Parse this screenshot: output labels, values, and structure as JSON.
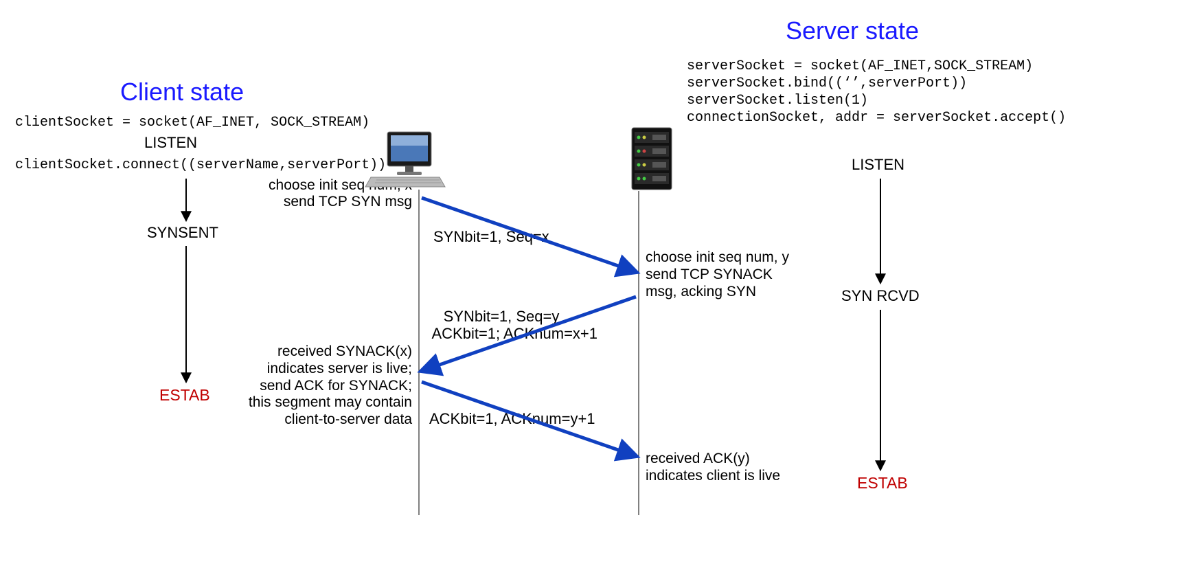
{
  "client": {
    "title": "Client state",
    "code1": "clientSocket = socket(AF_INET, SOCK_STREAM)",
    "state1": "LISTEN",
    "code2": "clientSocket.connect((serverName,serverPort))",
    "state2": "SYNSENT",
    "state3": "ESTAB",
    "note1_l1": "choose init seq num, x",
    "note1_l2": "send TCP SYN msg",
    "note2_l1": "received SYNACK(x)",
    "note2_l2": "indicates server is live;",
    "note2_l3": "send ACK for SYNACK;",
    "note2_l4": "this segment may contain",
    "note2_l5": "client-to-server data"
  },
  "server": {
    "title": "Server state",
    "code1": "serverSocket = socket(AF_INET,SOCK_STREAM)",
    "code2": "serverSocket.bind((‘’,serverPort))",
    "code3": "serverSocket.listen(1)",
    "code4": "connectionSocket, addr = serverSocket.accept()",
    "state1": "LISTEN",
    "state2": "SYN RCVD",
    "state3": "ESTAB",
    "note1_l1": "choose init seq num, y",
    "note1_l2": "send TCP SYNACK",
    "note1_l3": "msg, acking SYN",
    "note2_l1": "received ACK(y)",
    "note2_l2": "indicates client is live"
  },
  "messages": {
    "syn": "SYNbit=1, Seq=x",
    "synack_l1": "SYNbit=1, Seq=y",
    "synack_l2": "ACKbit=1; ACKnum=x+1",
    "ack": "ACKbit=1, ACKnum=y+1"
  }
}
